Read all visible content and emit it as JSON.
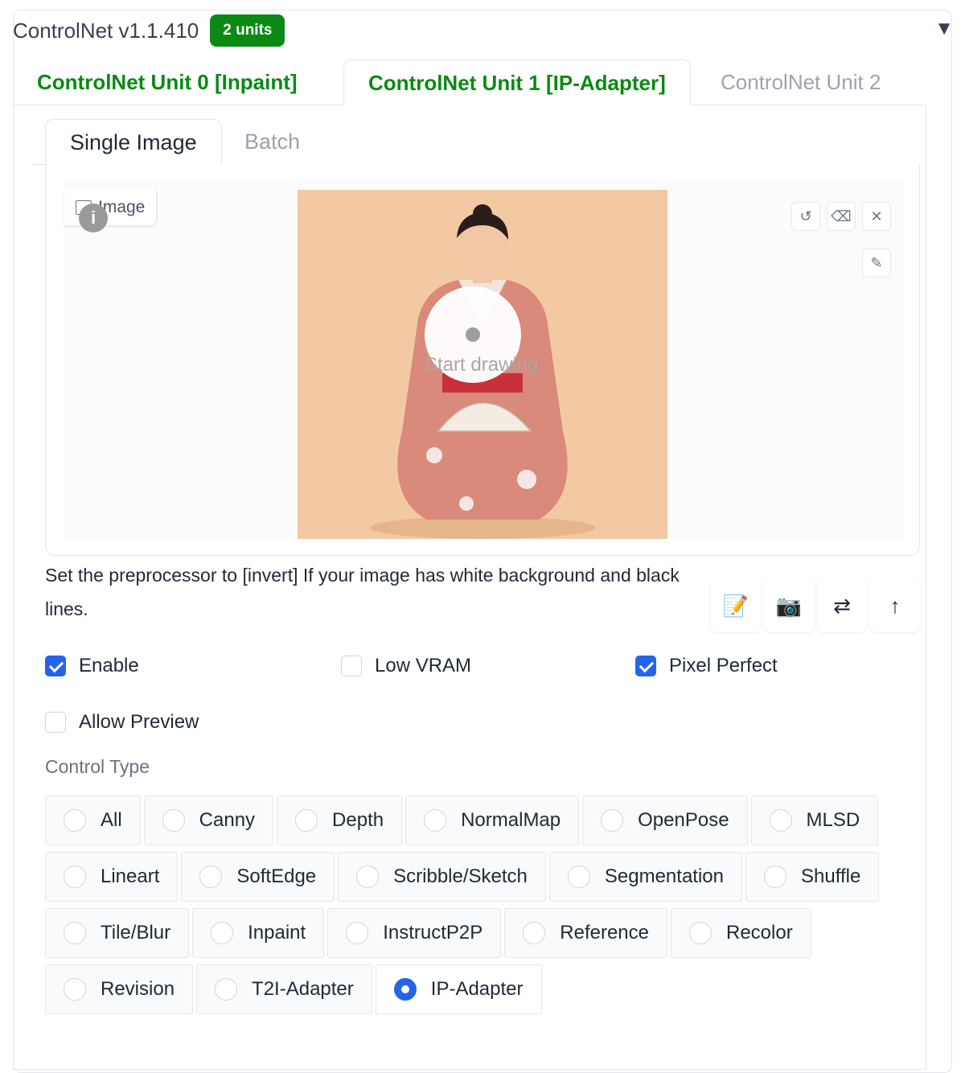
{
  "header": {
    "title": "ControlNet v1.1.410",
    "badge": "2 units",
    "collapse_icon": "▼"
  },
  "unit_tabs": [
    {
      "label": "ControlNet Unit 0 [Inpaint]",
      "active": false
    },
    {
      "label": "ControlNet Unit 1 [IP-Adapter]",
      "active": true
    },
    {
      "label": "ControlNet Unit 2",
      "active": false
    }
  ],
  "image_tabs": [
    {
      "label": "Single Image",
      "active": true
    },
    {
      "label": "Batch",
      "active": false
    }
  ],
  "canvas": {
    "image_label": "Image",
    "info_glyph": "i",
    "start_drawing": "Start drawing",
    "tools": {
      "undo": "↺",
      "eraser": "⌫",
      "clear": "✕",
      "brush": "✎"
    }
  },
  "hint": "Set the preprocessor to [invert] If your image has white background and black lines.",
  "actions": [
    {
      "name": "edit",
      "glyph": "📝"
    },
    {
      "name": "camera",
      "glyph": "📷"
    },
    {
      "name": "swap",
      "glyph": "⇄"
    },
    {
      "name": "send-up",
      "glyph": "↑"
    }
  ],
  "checkboxes": {
    "enable": {
      "label": "Enable",
      "checked": true
    },
    "low_vram": {
      "label": "Low VRAM",
      "checked": false
    },
    "pixel_perfect": {
      "label": "Pixel Perfect",
      "checked": true
    },
    "allow_preview": {
      "label": "Allow Preview",
      "checked": false
    }
  },
  "control_type": {
    "label": "Control Type",
    "rows": [
      [
        "All",
        "Canny",
        "Depth",
        "NormalMap",
        "OpenPose",
        "MLSD"
      ],
      [
        "Lineart",
        "SoftEdge",
        "Scribble/Sketch",
        "Segmentation",
        "Shuffle"
      ],
      [
        "Tile/Blur",
        "Inpaint",
        "InstructP2P",
        "Reference",
        "Recolor"
      ],
      [
        "Revision",
        "T2I-Adapter",
        "IP-Adapter"
      ]
    ],
    "selected": "IP-Adapter"
  },
  "colors": {
    "accent_green": "#0a8a12",
    "accent_blue": "#2563eb",
    "photo_bg": "#f3c9a3",
    "kimono": "#d98a7a"
  }
}
